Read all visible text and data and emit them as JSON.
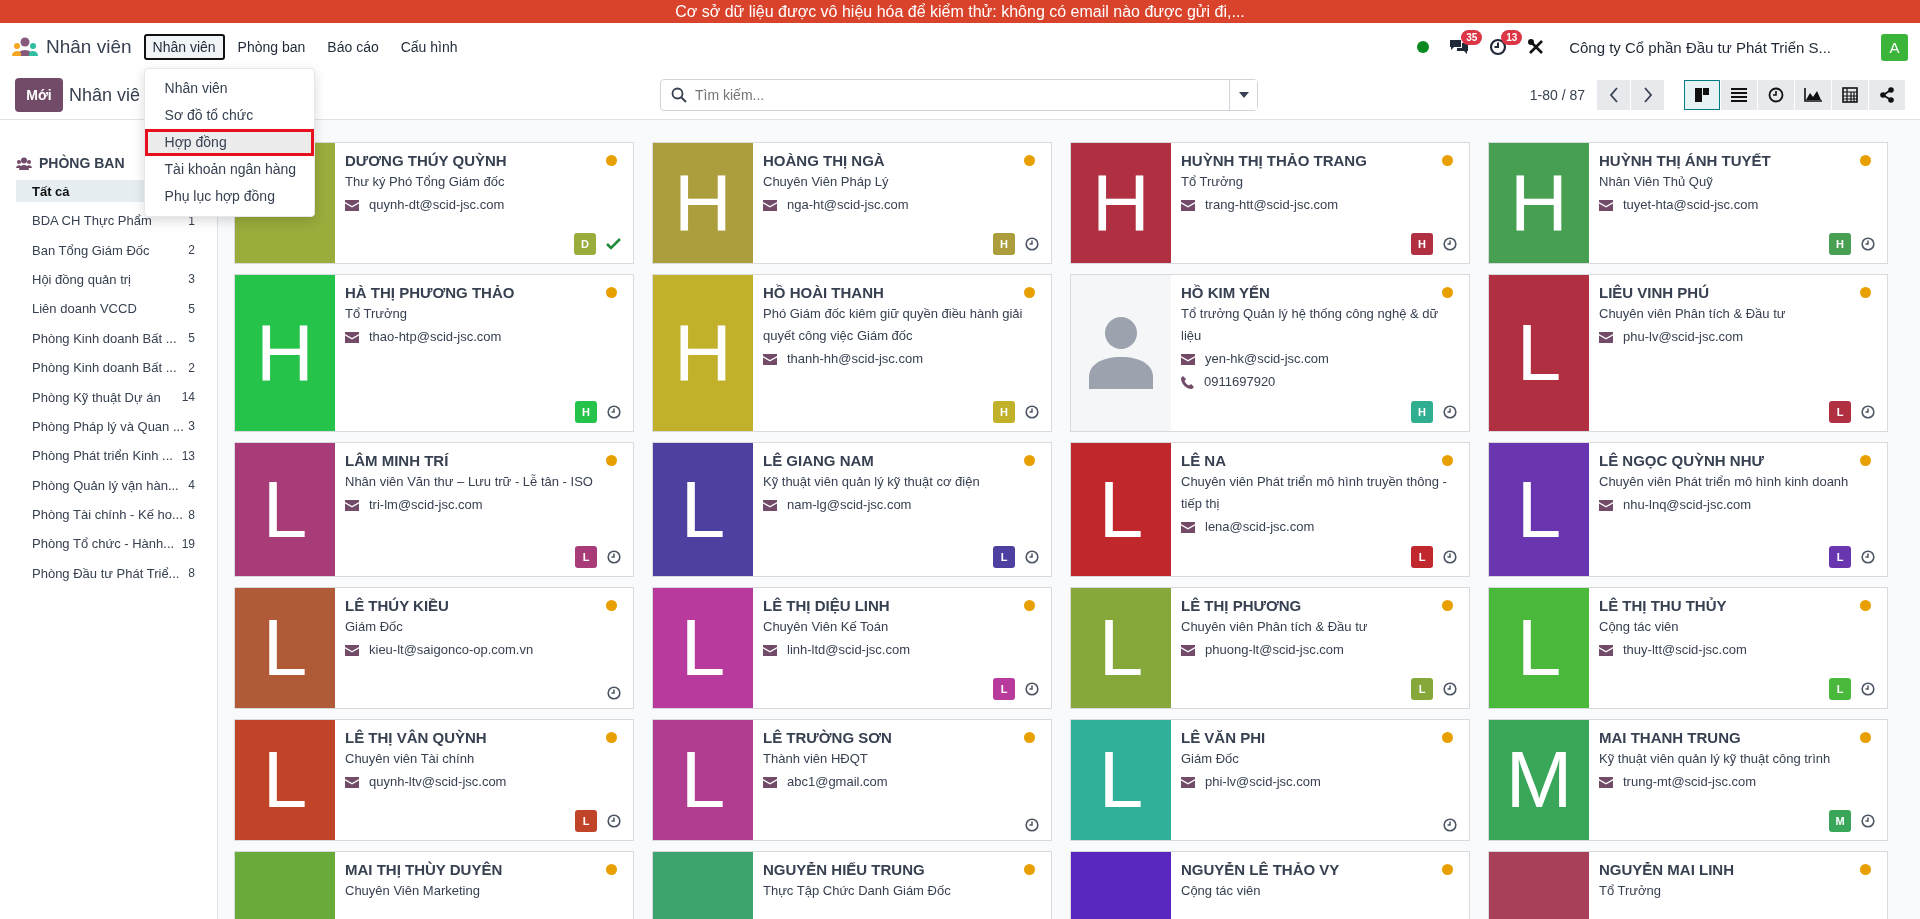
{
  "banner": {
    "text": "Cơ sở dữ liệu được vô hiệu hóa để kiểm thử: không có email nào được gửi đi,..."
  },
  "navbar": {
    "app_name": "Nhân viên",
    "menu": [
      {
        "label": "Nhân viên",
        "selected": true
      },
      {
        "label": "Phòng ban",
        "selected": false
      },
      {
        "label": "Báo cáo",
        "selected": false
      },
      {
        "label": "Cấu hình",
        "selected": false
      }
    ],
    "dropdown": [
      {
        "label": "Nhân viên",
        "selected": false
      },
      {
        "label": "Sơ đồ tổ chức",
        "selected": false
      },
      {
        "label": "Hợp đồng",
        "selected": true
      },
      {
        "label": "Tài khoản ngân hàng",
        "selected": false
      },
      {
        "label": "Phụ lục hợp đồng",
        "selected": false
      }
    ],
    "messages_count": "35",
    "activities_count": "13",
    "company": "Công ty Cổ phần Đầu tư Phát Triển S...",
    "user_initial": "A"
  },
  "control_panel": {
    "new_button": "Mới",
    "breadcrumb": "Nhân viê",
    "search": {
      "placeholder": "Tìm kiếm..."
    },
    "pager": "1-80 / 87",
    "views": [
      {
        "kind": "kanban",
        "selected": true
      },
      {
        "kind": "list",
        "selected": false
      },
      {
        "kind": "activity",
        "selected": false
      },
      {
        "kind": "graph",
        "selected": false
      },
      {
        "kind": "pivot",
        "selected": false
      },
      {
        "kind": "hierarchy",
        "selected": false
      }
    ]
  },
  "sidebar": {
    "title": "PHÒNG BAN",
    "items": [
      {
        "label": "Tất cả",
        "selected": true
      },
      {
        "label": "BDA CH Thực Phẩm",
        "count": "1",
        "selected": false
      },
      {
        "label": "Ban Tổng Giám Đốc",
        "count": "2",
        "selected": false
      },
      {
        "label": "Hội đồng quản trị",
        "count": "3",
        "selected": false
      },
      {
        "label": "Liên doanh VCCD",
        "count": "5",
        "selected": false
      },
      {
        "label": "Phòng Kinh doanh Bất ...",
        "count": "5",
        "selected": false
      },
      {
        "label": "Phòng Kinh doanh Bất ...",
        "count": "2",
        "selected": false
      },
      {
        "label": "Phòng Kỹ thuật Dự án",
        "count": "14",
        "selected": false
      },
      {
        "label": "Phòng Pháp lý và Quan ...",
        "count": "3",
        "selected": false
      },
      {
        "label": "Phòng Phát triển Kinh ...",
        "count": "13",
        "selected": false
      },
      {
        "label": "Phòng Quản lý vận hàn...",
        "count": "4",
        "selected": false
      },
      {
        "label": "Phòng Tài chính - Kế ho...",
        "count": "8",
        "selected": false
      },
      {
        "label": "Phòng Tổ chức - Hành...",
        "count": "19",
        "selected": false
      },
      {
        "label": "Phòng Đầu tư Phát Triể...",
        "count": "8",
        "selected": false
      }
    ]
  },
  "employees": [
    {
      "name": "DƯƠNG THÚY QUỲNH",
      "job": "Thư ký Phó Tổng Giám đốc",
      "email": "quynh-dt@scid-jsc.com",
      "avatar": {
        "kind": "letter",
        "color": "#9aac3c"
      },
      "badge": {
        "letter": "D",
        "color": "#9aac3c"
      },
      "activity_done": true
    },
    {
      "name": "HOÀNG THỊ NGÀ",
      "job": "Chuyên Viên Pháp Lý",
      "email": "nga-ht@scid-jsc.com",
      "avatar": {
        "kind": "letter",
        "letter": "H",
        "color": "#ac9e3c"
      },
      "badge": {
        "letter": "H",
        "color": "#ac9e3c"
      },
      "activity_done": false
    },
    {
      "name": "HUỲNH THỊ THẢO TRANG",
      "job": "Tổ Trưởng",
      "email": "trang-htt@scid-jsc.com",
      "avatar": {
        "kind": "letter",
        "letter": "H",
        "color": "#b03042"
      },
      "badge": {
        "letter": "H",
        "color": "#b03042"
      },
      "activity_done": false
    },
    {
      "name": "HUỲNH THỊ ÁNH TUYẾT",
      "job": "Nhân Viên Thủ Quỹ",
      "email": "tuyet-hta@scid-jsc.com",
      "avatar": {
        "kind": "letter",
        "letter": "H",
        "color": "#47a052"
      },
      "badge": {
        "letter": "H",
        "color": "#47a052"
      },
      "activity_done": false
    },
    {
      "name": "HÀ THỊ PHƯƠNG THẢO",
      "job": "Tổ Trưởng",
      "email": "thao-htp@scid-jsc.com",
      "avatar": {
        "kind": "letter",
        "letter": "H",
        "color": "#25c34a"
      },
      "badge": {
        "letter": "H",
        "color": "#25c34a"
      },
      "activity_done": false
    },
    {
      "name": "HỒ HOÀI THANH",
      "job": "Phó Giám đốc kiêm giữ quyền điều hành giải quyết công việc Giám đốc",
      "email": "thanh-hh@scid-jsc.com",
      "avatar": {
        "kind": "letter",
        "letter": "H",
        "color": "#c0b02a"
      },
      "badge": {
        "letter": "H",
        "color": "#c0b02a"
      },
      "activity_done": false
    },
    {
      "name": "HỒ KIM YẾN",
      "job": "Tổ trưởng Quản lý hệ thống công nghệ & dữ liệu",
      "email": "yen-hk@scid-jsc.com",
      "phone": "0911697920",
      "avatar": {
        "kind": "placeholder"
      },
      "badge": {
        "letter": "H",
        "color": "#2fae90"
      },
      "activity_done": false
    },
    {
      "name": "LIÊU VINH PHÚ",
      "job": "Chuyên viên Phân tích & Đầu tư",
      "email": "phu-lv@scid-jsc.com",
      "avatar": {
        "kind": "letter",
        "letter": "L",
        "color": "#b03042"
      },
      "badge": {
        "letter": "L",
        "color": "#b03042"
      },
      "activity_done": false
    },
    {
      "name": "LÂM MINH TRÍ",
      "job": "Nhân viên Văn thư – Lưu trữ - Lễ tân - ISO",
      "email": "tri-lm@scid-jsc.com",
      "avatar": {
        "kind": "letter",
        "letter": "L",
        "color": "#a83c78"
      },
      "badge": {
        "letter": "L",
        "color": "#a83c78"
      },
      "activity_done": false
    },
    {
      "name": "LÊ GIANG NAM",
      "job": "Kỹ thuật viên quản lý kỹ thuật cơ điện",
      "email": "nam-lg@scid-jsc.com",
      "avatar": {
        "kind": "letter",
        "letter": "L",
        "color": "#4c40a0"
      },
      "badge": {
        "letter": "L",
        "color": "#4c40a0"
      },
      "activity_done": false
    },
    {
      "name": "LÊ NA",
      "job": "Chuyên viên Phát triển mô hình truyền thông - tiếp thị",
      "email": "lena@scid-jsc.com",
      "avatar": {
        "kind": "letter",
        "letter": "L",
        "color": "#c0282e"
      },
      "badge": {
        "letter": "L",
        "color": "#c0282e"
      },
      "activity_done": false
    },
    {
      "name": "LÊ NGỌC QUỲNH NHƯ",
      "job": "Chuyên viên Phát triển mô hình kinh doanh",
      "email": "nhu-lnq@scid-jsc.com",
      "avatar": {
        "kind": "letter",
        "letter": "L",
        "color": "#6a36b0"
      },
      "badge": {
        "letter": "L",
        "color": "#6a36b0"
      },
      "activity_done": false
    },
    {
      "name": "LÊ THÚY KIỀU",
      "job": "Giám Đốc",
      "email": "kieu-lt@saigonco-op.com.vn",
      "avatar": {
        "kind": "letter",
        "letter": "L",
        "color": "#b05a38"
      },
      "activity_done": false
    },
    {
      "name": "LÊ THỊ DIỆU LINH",
      "job": "Chuyên Viên Kế Toán",
      "email": "linh-ltd@scid-jsc.com",
      "avatar": {
        "kind": "letter",
        "letter": "L",
        "color": "#b83a9c"
      },
      "badge": {
        "letter": "L",
        "color": "#b83a9c"
      },
      "activity_done": false
    },
    {
      "name": "LÊ THỊ PHƯƠNG",
      "job": "Chuyên viên Phân tích & Đầu tư",
      "email": "phuong-lt@scid-jsc.com",
      "avatar": {
        "kind": "letter",
        "letter": "L",
        "color": "#86a83a"
      },
      "badge": {
        "letter": "L",
        "color": "#86a83a"
      },
      "activity_done": false
    },
    {
      "name": "LÊ THỊ THU THỦY",
      "job": "Cộng tác viên",
      "email": "thuy-ltt@scid-jsc.com",
      "avatar": {
        "kind": "letter",
        "letter": "L",
        "color": "#4ab83a"
      },
      "badge": {
        "letter": "L",
        "color": "#4ab83a"
      },
      "activity_done": false
    },
    {
      "name": "LÊ THỊ VÂN QUỲNH",
      "job": "Chuyên viên Tài chính",
      "email": "quynh-ltv@scid-jsc.com",
      "avatar": {
        "kind": "letter",
        "letter": "L",
        "color": "#c04428"
      },
      "badge": {
        "letter": "L",
        "color": "#c04428"
      },
      "activity_done": false
    },
    {
      "name": "LÊ TRƯỜNG SƠN",
      "job": "Thành viên HĐQT",
      "email": "abc1@gmail.com",
      "avatar": {
        "kind": "letter",
        "letter": "L",
        "color": "#b03c90"
      },
      "activity_done": false
    },
    {
      "name": "LÊ VĂN PHI",
      "job": "Giám Đốc",
      "email": "phi-lv@scid-jsc.com",
      "avatar": {
        "kind": "letter",
        "letter": "L",
        "color": "#30b098"
      },
      "activity_done": false
    },
    {
      "name": "MAI THANH TRUNG",
      "job": "Kỹ thuật viên quản lý kỹ thuật công trình",
      "email": "trung-mt@scid-jsc.com",
      "avatar": {
        "kind": "letter",
        "letter": "M",
        "color": "#3aa65a"
      },
      "badge": {
        "letter": "M",
        "color": "#3aa65a"
      },
      "activity_done": false
    },
    {
      "name": "MAI THỊ THÙY DUYÊN",
      "job": "Chuyên Viên Marketing",
      "avatar": {
        "kind": "letter",
        "color": "#6aaa3a"
      }
    },
    {
      "name": "NGUYỄN HIẾU TRUNG",
      "job": "Thực Tập Chức Danh Giám Đốc",
      "avatar": {
        "kind": "letter",
        "color": "#3ea46e"
      }
    },
    {
      "name": "NGUYỄN LÊ THẢO VY",
      "job": "Cộng tác viên",
      "avatar": {
        "kind": "letter",
        "color": "#5a26c0"
      }
    },
    {
      "name": "NGUYỄN MAI LINH",
      "job": "Tổ Trưởng",
      "avatar": {
        "kind": "letter",
        "color": "#a8405a"
      }
    }
  ]
}
